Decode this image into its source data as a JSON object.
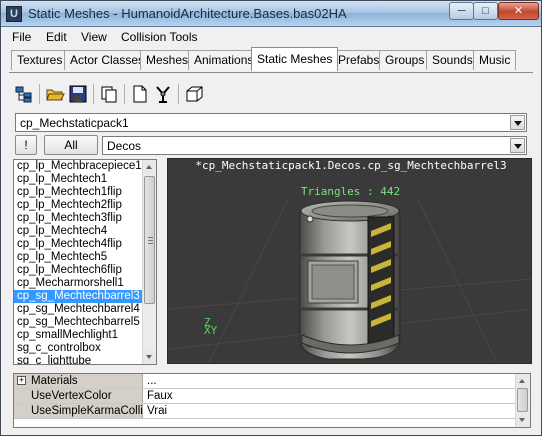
{
  "window": {
    "title": "Static Meshes - HumanoidArchitecture.Bases.bas02HA",
    "app_icon": "unreal-editor-icon",
    "controls": {
      "minimize": "minimize-icon",
      "maximize": "maximize-icon",
      "close": "close-icon"
    }
  },
  "menu": [
    "File",
    "Edit",
    "View",
    "Collision Tools"
  ],
  "tabs": [
    {
      "label": "Textures",
      "active": false
    },
    {
      "label": "Actor Classes",
      "active": false
    },
    {
      "label": "Meshes",
      "active": false
    },
    {
      "label": "Animations",
      "active": false
    },
    {
      "label": "Static Meshes",
      "active": true
    },
    {
      "label": "Prefabs",
      "active": false
    },
    {
      "label": "Groups",
      "active": false
    },
    {
      "label": "Sounds",
      "active": false
    },
    {
      "label": "Music",
      "active": false
    }
  ],
  "toolbar": {
    "buttons": [
      "package-tree-icon",
      "open-folder-icon",
      "save-icon",
      "copy-icon",
      "new-document-icon",
      "tools-icon",
      "cube-icon"
    ]
  },
  "package_combo": {
    "value": "cp_Mechstaticpack1"
  },
  "filter": {
    "bang_label": "!",
    "all_label": "All",
    "group_value": "Decos"
  },
  "mesh_list": {
    "items": [
      "cp_lp_Mechbracepiece1",
      "cp_lp_Mechtech1",
      "cp_lp_Mechtech1flip",
      "cp_lp_Mechtech2flip",
      "cp_lp_Mechtech3flip",
      "cp_lp_Mechtech4",
      "cp_lp_Mechtech4flip",
      "cp_lp_Mechtech5",
      "cp_lp_Mechtech6flip",
      "cp_Mecharmorshell1",
      "cp_sg_Mechtechbarrel3",
      "cp_sg_Mechtechbarrel4",
      "cp_sg_Mechtechbarrel5",
      "cp_smallMechlight1",
      "sg_c_controlbox",
      "sg_c_lighttube"
    ],
    "selected": "cp_sg_Mechtechbarrel3"
  },
  "viewport": {
    "mesh_name": "*cp_Mechstaticpack1.Decos.cp_sg_Mechtechbarrel3",
    "triangles": "Triangles : 442",
    "axis_z": "Z",
    "axis_xy": "XY",
    "colors": {
      "background": "#3a3a3a",
      "text": "#ffffff",
      "triangles": "#7ee07e",
      "axis": "#4ddb4d"
    }
  },
  "properties": {
    "rows": [
      {
        "name": "Materials",
        "value": "...",
        "expandable": true
      },
      {
        "name": "UseVertexColor",
        "value": "Faux",
        "expandable": false
      },
      {
        "name": "UseSimpleKarmaColli...",
        "value": "Vrai",
        "expandable": false
      }
    ]
  },
  "colors": {
    "selection": "#3399ff",
    "chrome": "#f0f0f0"
  }
}
